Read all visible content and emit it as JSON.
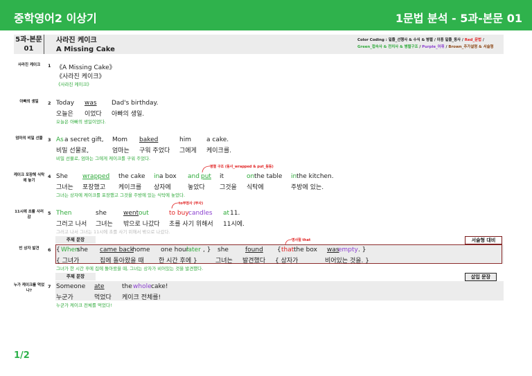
{
  "header": {
    "title_left": "중학영어2 이상기",
    "title_right": "1문법 분석 - 5과-본문 01"
  },
  "lesson": {
    "code": "5과-본문",
    "code_num": "01",
    "title_ko": "사라진 케이크",
    "title_en": "A Missing Cake",
    "color_coding": {
      "line1_a": "Color Coding : 밑줄_선행사 & 수식 & 병렬 / 이중 밑줄_동사 / ",
      "line1_b": "Red_문법",
      "line1_c": " /",
      "line2_a": "Green_접속사 & 전치사 & 병렬구조",
      "line2_b": " / ",
      "line2_c": "Purple_어휘",
      "line2_d": " / ",
      "line2_e": "Brown_추가설명 & 서술형"
    }
  },
  "sentences": [
    {
      "label": "사라진 케이크",
      "num": "1",
      "en": "《A Missing Cake》",
      "ko": "《사라진 케이크》",
      "trans": "《사라진 케이크》"
    },
    {
      "label": "아빠의 생일",
      "num": "2",
      "words": [
        "Today",
        "was",
        "Dad's birthday."
      ],
      "ko_words": [
        "오늘은",
        "이었다",
        "아빠의 생일."
      ],
      "trans": "오늘은 아빠의 생일이었다."
    },
    {
      "label": "엄마의 비밀 선물",
      "num": "3",
      "words": [
        "As",
        " a secret gift,",
        "Mom",
        "baked",
        "him",
        "a cake."
      ],
      "ko_words": [
        "비밀 선물로,",
        "엄마는",
        "구워 주었다",
        "그에게",
        "케이크를."
      ],
      "trans": "비밀 선물로, 엄마는 그에게 케이크를 구워 주었다."
    },
    {
      "label": "케이크 포장해 식탁에 놓기",
      "num": "4",
      "note": "병렬 구조 (동사_wrapped & put_동등)",
      "words": [
        "She",
        "wrapped",
        "the cake",
        "in",
        " a box",
        "and",
        "put",
        "it",
        "on",
        " the table",
        "in",
        " the kitchen."
      ],
      "ko_words": [
        "그녀는",
        "포장했고",
        "케이크를",
        "상자에",
        "놓았다",
        "그것을",
        "식탁에",
        "주방에 있는."
      ],
      "trans": "그녀는 상자에 케이크를 포장했고 그것을 주방에 있는 식탁에 놓았다."
    },
    {
      "label": "11시에 초를 사러 감",
      "num": "5",
      "note": "to부정사 (부사)",
      "words": [
        "Then",
        "she",
        "went",
        " out",
        "to buy",
        " candles",
        "at",
        " 11."
      ],
      "ko_words": [
        "그러고 나서",
        "그녀는",
        "밖으로 나갔다",
        "초를 사기 위해서",
        "11시에."
      ],
      "trans": "그러고 나서 그녀는 11시에 초를 사기 위해서 밖으로 나갔다."
    },
    {
      "label": "빈 상자 발견",
      "num": "6",
      "tag_left": "주제 문장",
      "tag_right": "서술형 대비",
      "note": "명사절 that",
      "words": [
        "{ ",
        "When",
        " she",
        "came back",
        " home",
        "one hour",
        " later",
        ", }",
        "she",
        "found",
        "{ ",
        "that",
        " the box",
        "was",
        " empty",
        ". }"
      ],
      "ko_words": [
        "{ 그녀가",
        "집에 돌아왔을 때",
        "한 시간 후에 }",
        "그녀는",
        "발견했다",
        "{ 상자가",
        "비어있는 것을. }"
      ],
      "trans": "그녀가 한 시간 후에 집에 돌아왔을 때, 그녀는 상자가 비어있는 것을 발견했다."
    },
    {
      "label": "누가 케이크를 먹었나?",
      "num": "7",
      "tag_left": "주제 문장",
      "tag_right": "삽입 문장",
      "words": [
        "Someone",
        "ate",
        "the",
        " whole",
        " cake!"
      ],
      "ko_words": [
        "누군가",
        "먹었다",
        "케이크 전체를!"
      ],
      "trans": "누군가 케이크 전체를 먹었다!"
    }
  ],
  "footer": {
    "page": "1/2"
  }
}
